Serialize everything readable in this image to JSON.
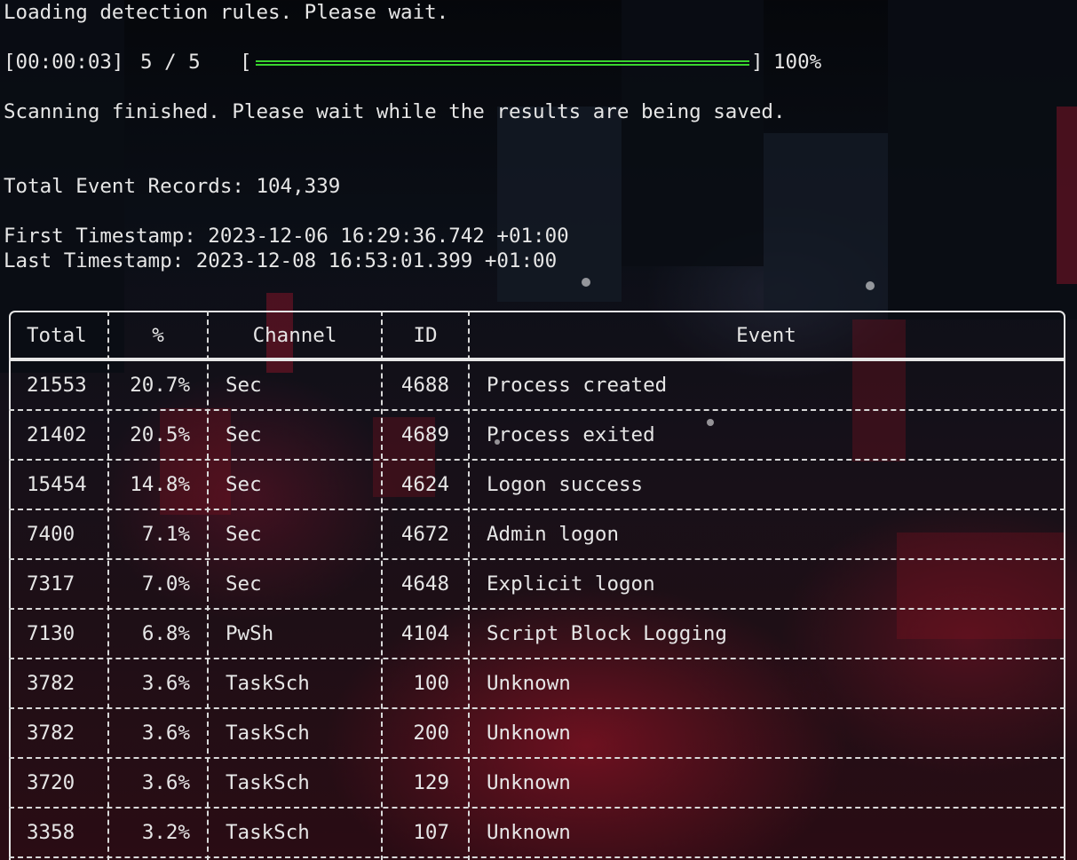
{
  "terminal": {
    "loading_line": "Loading detection rules. Please wait.",
    "progress": {
      "elapsed": "[00:00:03]",
      "count": "5 / 5",
      "bracket_open": "[",
      "bracket_close": "]",
      "percent_label": "100%",
      "fraction": 1.0,
      "bar_color": "#39d42f"
    },
    "scan_finished_line": "Scanning finished. Please wait while the results are being saved.",
    "total_records_line": "Total Event Records: 104,339",
    "first_timestamp_line": "First Timestamp: 2023-12-06 16:29:36.742 +01:00",
    "last_timestamp_line": "Last Timestamp: 2023-12-08 16:53:01.399 +01:00"
  },
  "table": {
    "headers": [
      "Total",
      "%",
      "Channel",
      "ID",
      "Event"
    ],
    "rows": [
      {
        "total": "21553",
        "pct": "20.7%",
        "channel": "Sec",
        "id": "4688",
        "event": "Process created"
      },
      {
        "total": "21402",
        "pct": "20.5%",
        "channel": "Sec",
        "id": "4689",
        "event": "Process exited"
      },
      {
        "total": "15454",
        "pct": "14.8%",
        "channel": "Sec",
        "id": "4624",
        "event": "Logon success"
      },
      {
        "total": "7400",
        "pct": "7.1%",
        "channel": "Sec",
        "id": "4672",
        "event": "Admin logon"
      },
      {
        "total": "7317",
        "pct": "7.0%",
        "channel": "Sec",
        "id": "4648",
        "event": "Explicit logon"
      },
      {
        "total": "7130",
        "pct": "6.8%",
        "channel": "PwSh",
        "id": "4104",
        "event": "Script Block Logging"
      },
      {
        "total": "3782",
        "pct": "3.6%",
        "channel": "TaskSch",
        "id": "100",
        "event": "Unknown"
      },
      {
        "total": "3782",
        "pct": "3.6%",
        "channel": "TaskSch",
        "id": "200",
        "event": "Unknown"
      },
      {
        "total": "3720",
        "pct": "3.6%",
        "channel": "TaskSch",
        "id": "129",
        "event": "Unknown"
      },
      {
        "total": "3358",
        "pct": "3.2%",
        "channel": "TaskSch",
        "id": "107",
        "event": "Unknown"
      }
    ]
  },
  "colors": {
    "text": "#e6e6e6",
    "progress_green": "#39d42f",
    "background_accent": "#2a0c14"
  }
}
